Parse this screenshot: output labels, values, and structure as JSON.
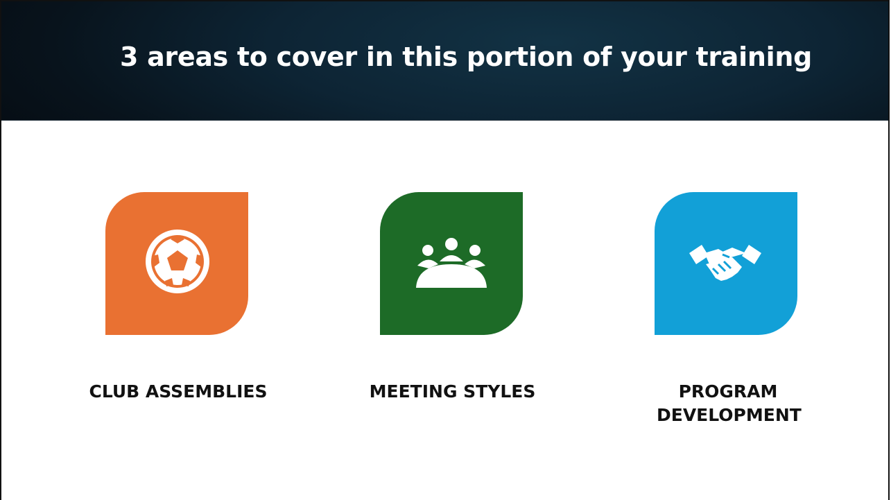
{
  "slide": {
    "title": "3 areas to cover in this portion of your training"
  },
  "areas": [
    {
      "label": "CLUB ASSEMBLIES",
      "icon": "soccer-ball-icon",
      "color": "#e97132"
    },
    {
      "label": "MEETING STYLES",
      "icon": "meeting-group-icon",
      "color": "#1d6b27"
    },
    {
      "label_lines": [
        "PROGRAM",
        "DEVELOPMENT"
      ],
      "icon": "handshake-icon",
      "color": "#12a0d7"
    }
  ]
}
